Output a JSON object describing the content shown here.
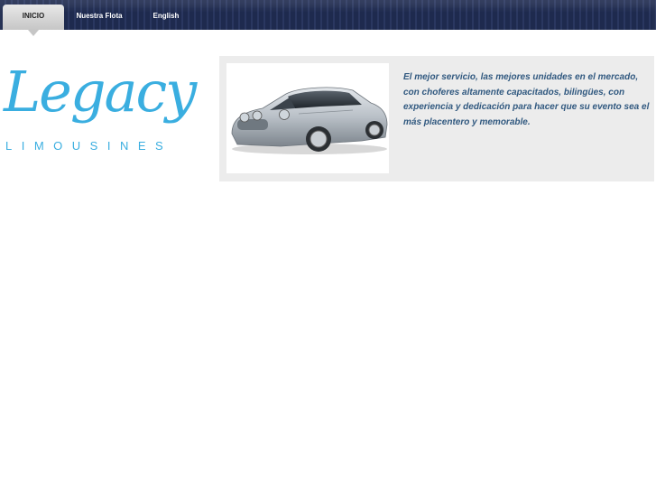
{
  "nav": {
    "items": [
      {
        "label": "INICIO",
        "active": true
      },
      {
        "label": "Nuestra Flota",
        "active": false
      },
      {
        "label": "English",
        "active": false
      }
    ]
  },
  "logo": {
    "script": "Legacy",
    "subtitle": "LIMOUSINES",
    "color": "#3aaee0"
  },
  "hero": {
    "image_icon": "car-icon",
    "tagline": "El mejor servicio, las mejores unidades en el mercado, con choferes altamente capacitados, bilingües, con experiencia y dedicación para hacer que su evento sea el más placentero y memorable."
  },
  "colors": {
    "nav_bg": "#1e2a4e",
    "panel_bg": "#ececec",
    "tagline": "#30587f"
  }
}
